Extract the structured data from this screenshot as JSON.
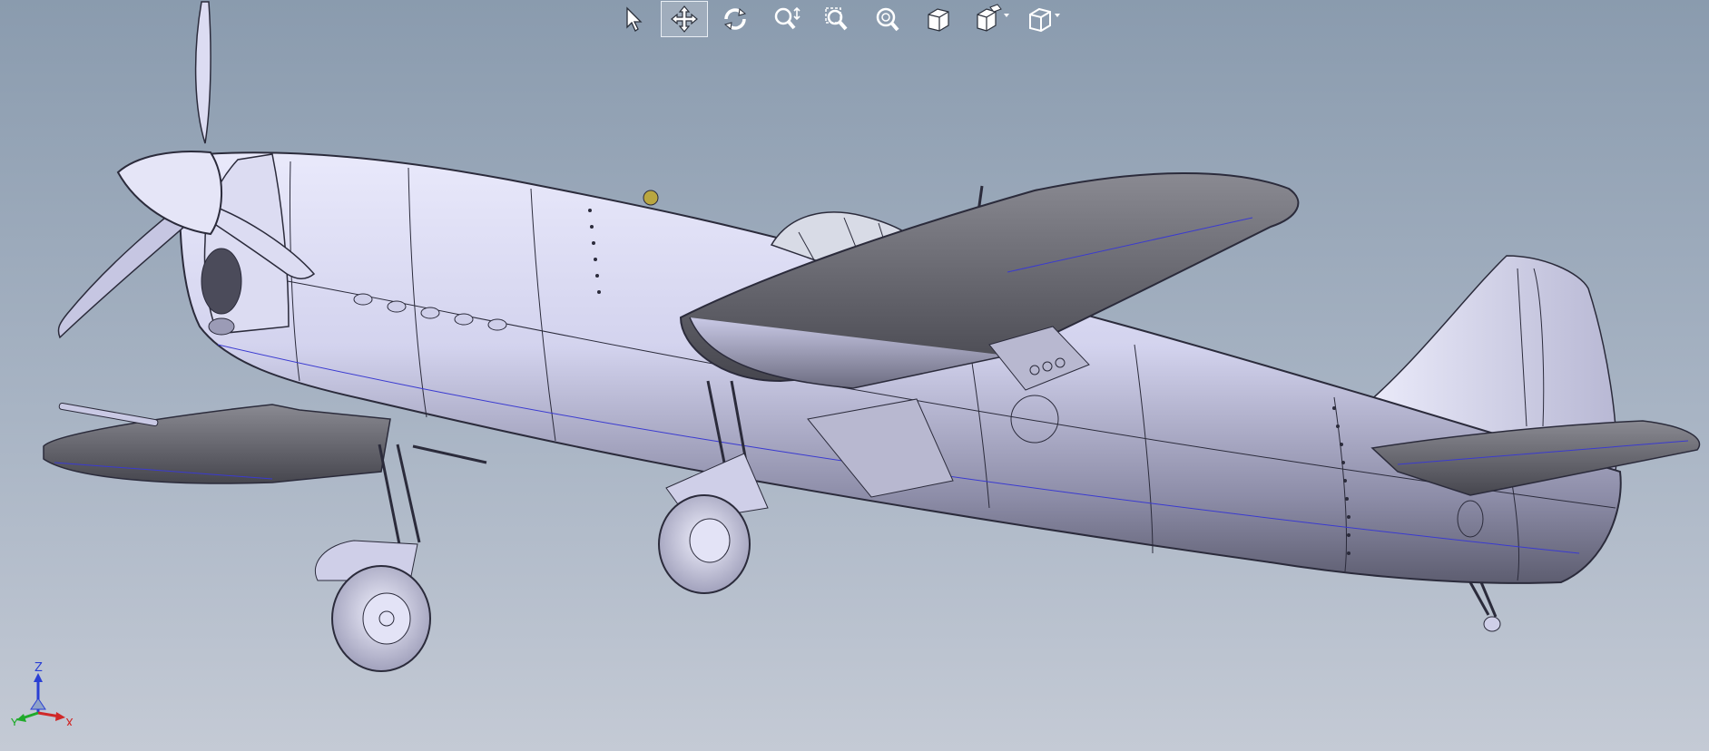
{
  "viewport": {
    "background_top": "#8a9bae",
    "background_bottom": "#c4cad5",
    "model_shade": "#d8d8f0",
    "edge_color": "#2b2b3b"
  },
  "toolbar": {
    "tools": [
      {
        "name": "select",
        "icon": "cursor-arrow-icon",
        "active": false
      },
      {
        "name": "pan",
        "icon": "pan-move-icon",
        "active": true
      },
      {
        "name": "rotate",
        "icon": "rotate-view-icon",
        "active": false
      },
      {
        "name": "zoom-in-out",
        "icon": "zoom-in-out-icon",
        "active": false
      },
      {
        "name": "zoom-to-area",
        "icon": "zoom-to-area-icon",
        "active": false
      },
      {
        "name": "zoom-to-fit",
        "icon": "zoom-to-fit-icon",
        "active": false
      },
      {
        "name": "view-orientation",
        "icon": "standard-view-cube-icon",
        "active": false
      },
      {
        "name": "display-style",
        "icon": "display-style-icon",
        "active": false,
        "dropdown": true
      },
      {
        "name": "hide-show-items",
        "icon": "hide-show-cube-icon",
        "active": false,
        "dropdown": true
      }
    ]
  },
  "triad": {
    "x_label": "X",
    "y_label": "Y",
    "z_label": "Z"
  }
}
